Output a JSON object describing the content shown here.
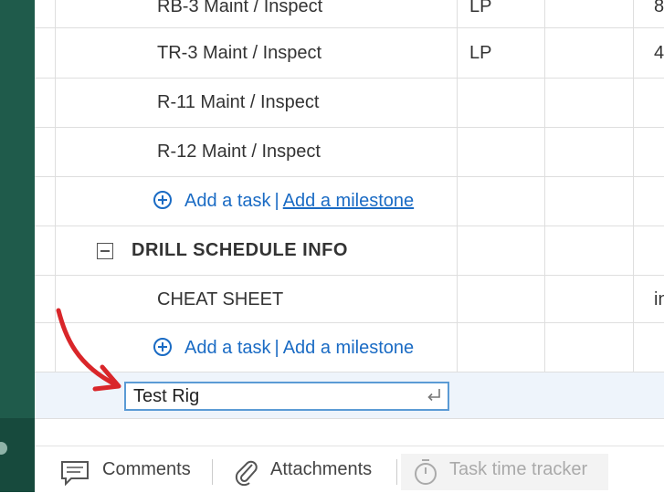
{
  "tasks": [
    {
      "name": "RB-3 Maint / Inspect",
      "col1": "LP",
      "col3": "8"
    },
    {
      "name": "TR-3 Maint / Inspect",
      "col1": "LP",
      "col3": "4"
    },
    {
      "name": "R-11 Maint / Inspect",
      "col1": "",
      "col3": ""
    },
    {
      "name": "R-12 Maint / Inspect",
      "col1": "",
      "col3": ""
    }
  ],
  "add_row": {
    "add_task": "Add a task",
    "separator": "|",
    "add_milestone": "Add a milestone"
  },
  "section": {
    "title": "DRILL SCHEDULE INFO"
  },
  "section_tasks": [
    {
      "name": "CHEAT SHEET",
      "col3": "in"
    }
  ],
  "edit": {
    "value": "Test Rig"
  },
  "bottom_tabs": {
    "comments": "Comments",
    "attachments": "Attachments",
    "task_time_tracker": "Task time tracker"
  },
  "colors": {
    "sidebar": "#1f5b4b",
    "link": "#1a6bc4",
    "annotation": "#d9262a"
  },
  "icons": [
    "plus-circle-icon",
    "collapse-minus-icon",
    "enter-icon",
    "comment-icon",
    "paperclip-icon",
    "stopwatch-icon",
    "red-arrow-annotation"
  ]
}
